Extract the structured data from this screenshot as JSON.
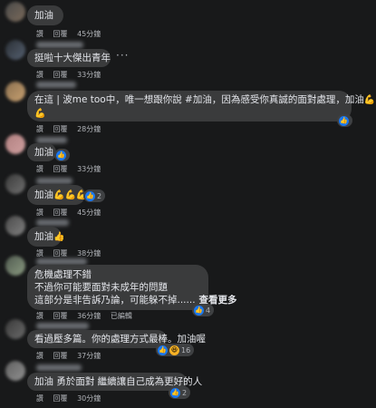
{
  "actions": {
    "like": "讚",
    "reply": "回覆"
  },
  "more_options": "···",
  "comments": [
    {
      "text": "加油",
      "time": "45分鐘"
    },
    {
      "text": "挺啦十大傑出青年",
      "time": "33分鐘"
    },
    {
      "lines": [
        "在這 | 波me too中，唯一想跟你說 #加油，因為感受你真誠的面對處理，加油",
        ""
      ],
      "emoji": "💪💪",
      "emoji2": "💪",
      "time": "28分鐘",
      "reaction_count": ""
    },
    {
      "text": "加油",
      "time": "33分鐘"
    },
    {
      "text": "加油",
      "emoji": "💪💪💪",
      "time": "45分鐘",
      "reaction_count": "2"
    },
    {
      "text": "加油",
      "emoji": "👍",
      "time": "38分鐘"
    },
    {
      "lines": [
        "危機處理不錯",
        "不過你可能要面對未成年的問題",
        "這部分是非告訴乃論，可能躲不掉......"
      ],
      "see_more": "查看更多",
      "time": "36分鐘",
      "extra": "已編輯",
      "reaction_count": "4"
    },
    {
      "text": "看過壓多篇。你的處理方式最棒。加油喔",
      "time": "37分鐘",
      "reaction_count": "16"
    },
    {
      "text": "加油 勇於面對 繼續讓自己成為更好的人",
      "time": "30分鐘",
      "reaction_count": "2"
    }
  ],
  "colors": {
    "background": "#18191a",
    "bubble": "#3a3b3c",
    "like": "#1877f2",
    "meta_text": "#b0b3b8"
  }
}
